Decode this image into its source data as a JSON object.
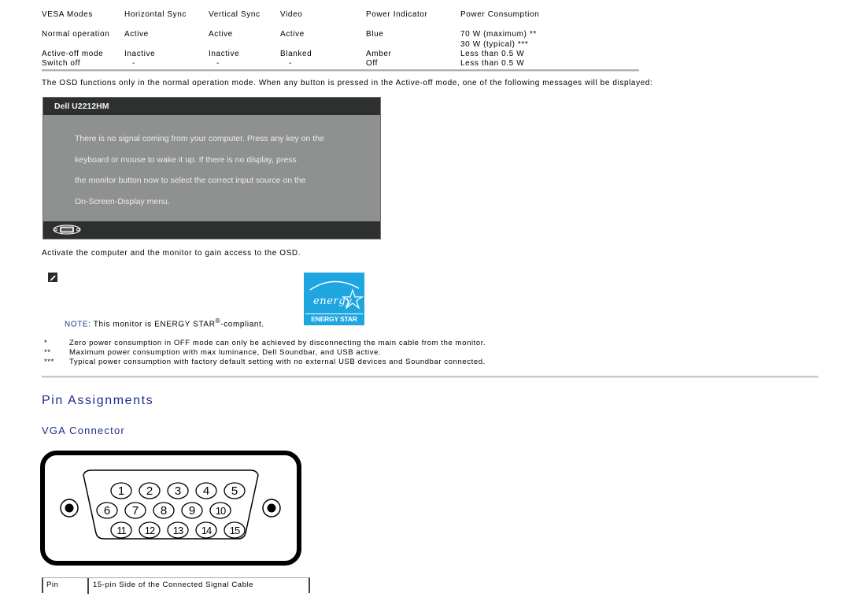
{
  "power_table": {
    "headers": [
      "VESA Modes",
      "Horizontal Sync",
      "Vertical Sync",
      "Video",
      "Power Indicator",
      "Power Consumption"
    ],
    "rows": [
      [
        "Normal operation",
        "Active",
        "Active",
        "Active",
        "Blue",
        "70 W (maximum) **"
      ],
      [
        "",
        "",
        "",
        "",
        "",
        "30 W (typical) ***"
      ],
      [
        "Active-off mode",
        "Inactive",
        "Inactive",
        "Blanked",
        "Amber",
        "Less than 0.5 W"
      ],
      [
        "Switch off",
        "-",
        "-",
        "-",
        "Off",
        "Less than 0.5 W"
      ]
    ]
  },
  "osd_paragraph": "The OSD functions only in the normal operation mode. When any button is pressed in the Active-off mode, one of the following messages will be displayed:",
  "osd_message": {
    "title": "Dell U2212HM",
    "lines": [
      "There is no signal coming from your computer. Press any key on the",
      "keyboard or mouse to wake it up. If there is no display, press",
      "the monitor button now to select the correct input source on the",
      "On-Screen-Display menu."
    ],
    "input_icon": "vga-input-icon"
  },
  "activate_text": "Activate the computer and the monitor to gain access to the OSD.",
  "note": {
    "icon": "note-pencil-icon",
    "label": "NOTE:",
    "text_before": " This monitor is ENERGY STAR",
    "registered": "®",
    "text_after": "-compliant.",
    "logo_text": "ENERGY STAR",
    "logo_script": "energy",
    "logo_color": "#1fa6e1"
  },
  "footnotes": [
    {
      "mark": "*",
      "text": "Zero power consumption in OFF mode can only be achieved by disconnecting the main cable from the monitor."
    },
    {
      "mark": "**",
      "text": "Maximum power consumption with max luminance, Dell Soundbar, and USB active."
    },
    {
      "mark": "***",
      "text": "Typical power consumption with factory default setting with no external USB devices and Soundbar connected."
    }
  ],
  "section_title": "Pin Assignments",
  "subsection_title": "VGA Connector",
  "vga_pins": {
    "row1": [
      "1",
      "2",
      "3",
      "4",
      "5"
    ],
    "row2": [
      "6",
      "7",
      "8",
      "9",
      "10"
    ],
    "row3": [
      "11",
      "12",
      "13",
      "14",
      "15"
    ]
  },
  "pin_table": {
    "headers": [
      "Pin",
      "15-pin Side of the Connected Signal Cable"
    ]
  },
  "colors": {
    "heading": "#1d2b8f",
    "osd_bg": "#8f9190",
    "osd_bar": "#2d302f"
  }
}
